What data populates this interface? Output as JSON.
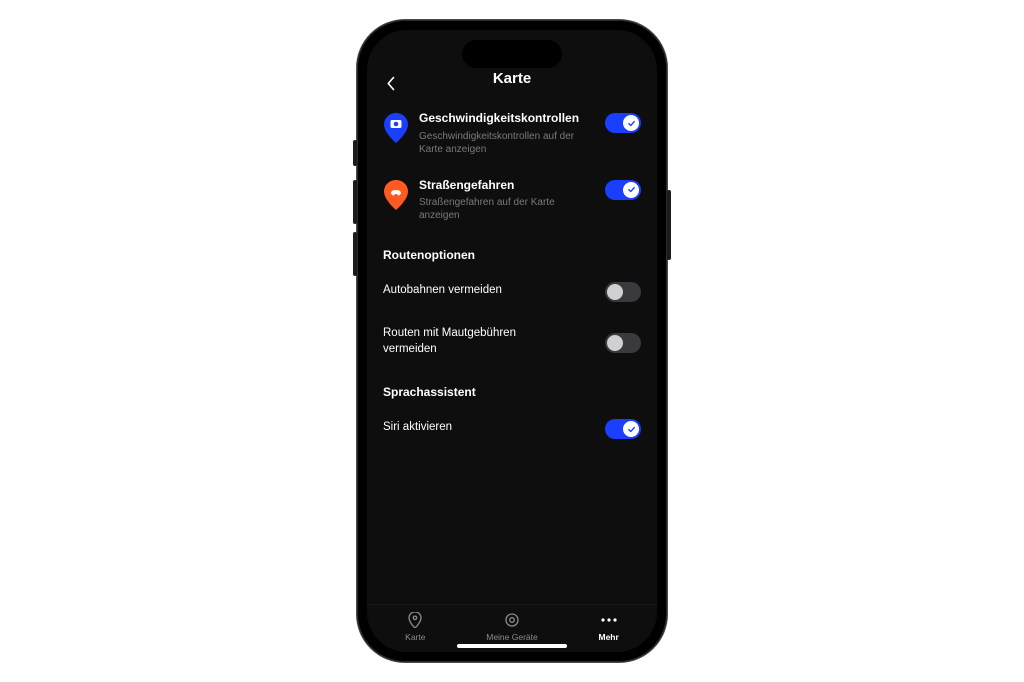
{
  "header": {
    "title": "Karte"
  },
  "settings": {
    "speed": {
      "title": "Geschwindigkeitskontrollen",
      "subtitle": "Geschwindigkeitskontrollen auf der Karte anzeigen",
      "on": true,
      "pin_color": "#1a3fff"
    },
    "hazards": {
      "title": "Straßengefahren",
      "subtitle": "Straßengefahren auf der Karte anzeigen",
      "on": true,
      "pin_color": "#ff5a1f"
    }
  },
  "routes": {
    "heading": "Routenoptionen",
    "avoid_highways": {
      "label": "Autobahnen vermeiden",
      "on": false
    },
    "avoid_tolls": {
      "label": "Routen mit Mautgebühren vermeiden",
      "on": false
    }
  },
  "voice": {
    "heading": "Sprachassistent",
    "siri": {
      "label": "Siri aktivieren",
      "on": true
    }
  },
  "tabs": {
    "map": "Karte",
    "devices": "Meine Geräte",
    "more": "Mehr"
  }
}
